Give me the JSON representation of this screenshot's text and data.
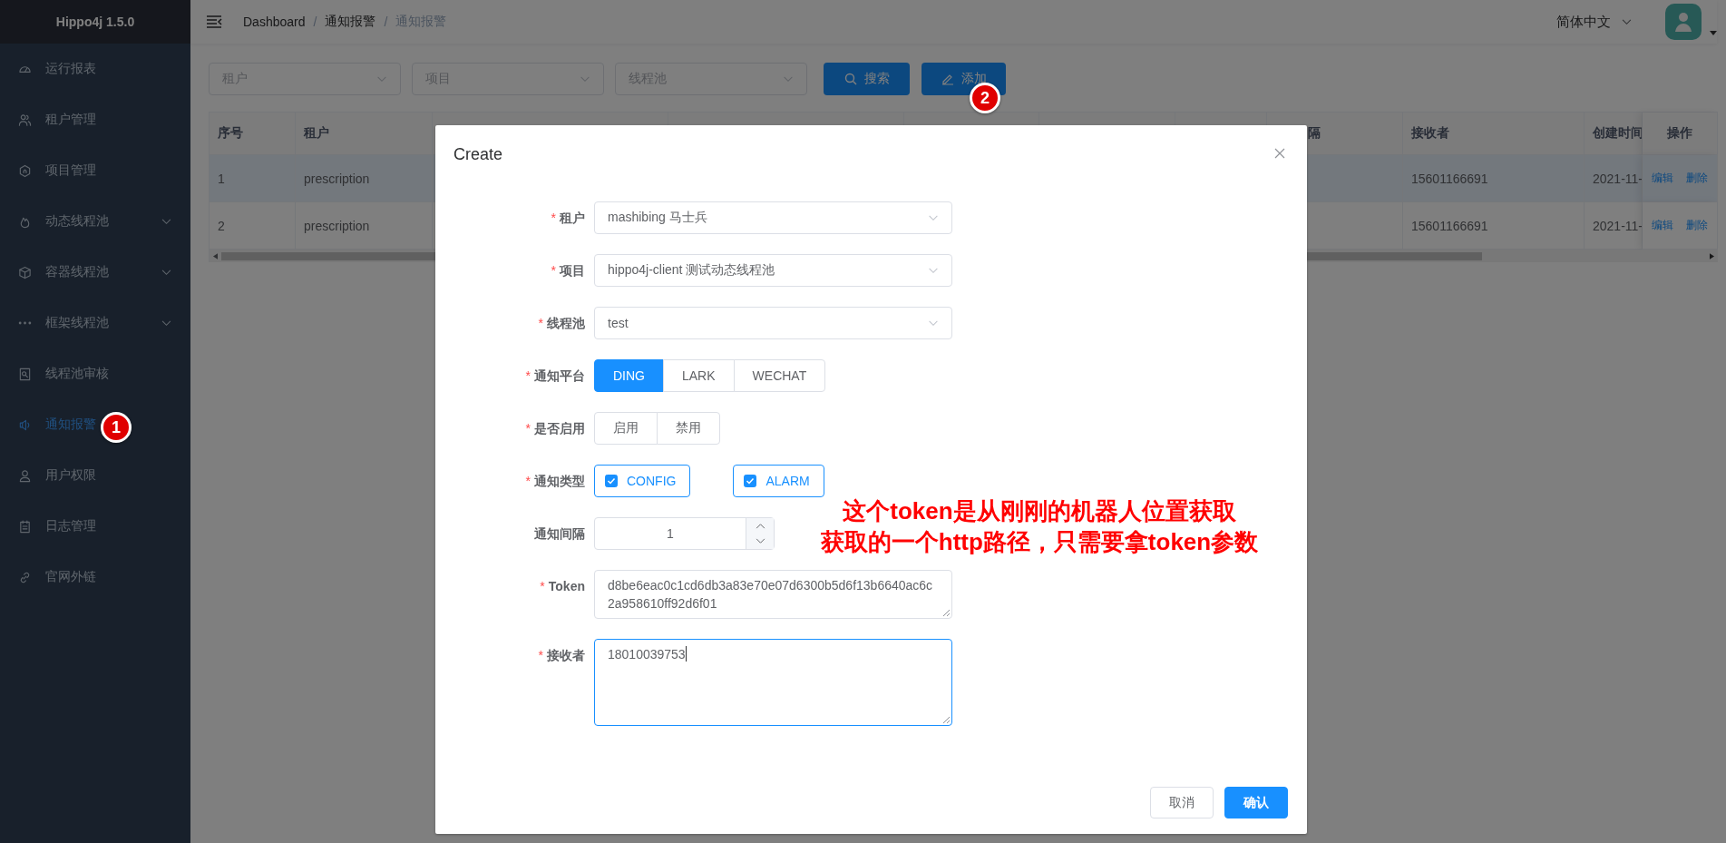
{
  "sidebar": {
    "title": "Hippo4j 1.5.0",
    "items": [
      {
        "label": "运行报表",
        "selected": false,
        "submenu": false
      },
      {
        "label": "租户管理",
        "selected": false,
        "submenu": false
      },
      {
        "label": "项目管理",
        "selected": false,
        "submenu": false
      },
      {
        "label": "动态线程池",
        "selected": false,
        "submenu": true
      },
      {
        "label": "容器线程池",
        "selected": false,
        "submenu": true
      },
      {
        "label": "框架线程池",
        "selected": false,
        "submenu": true
      },
      {
        "label": "线程池审核",
        "selected": false,
        "submenu": false
      },
      {
        "label": "通知报警",
        "selected": true,
        "submenu": false
      },
      {
        "label": "用户权限",
        "selected": false,
        "submenu": false
      },
      {
        "label": "日志管理",
        "selected": false,
        "submenu": false
      },
      {
        "label": "官网外链",
        "selected": false,
        "submenu": false
      }
    ]
  },
  "header": {
    "breadcrumb": [
      {
        "label": "Dashboard",
        "current": false
      },
      {
        "label": "通知报警",
        "current": false
      },
      {
        "label": "通知报警",
        "current": true
      }
    ],
    "separators": [
      "/",
      "/"
    ],
    "language": "简体中文"
  },
  "filters": {
    "selects": [
      {
        "placeholder": "租户"
      },
      {
        "placeholder": "项目"
      },
      {
        "placeholder": "线程池"
      }
    ],
    "buttons": [
      {
        "label": "搜索",
        "kind": "search"
      },
      {
        "label": "添加",
        "kind": "add"
      }
    ]
  },
  "table": {
    "columns": [
      {
        "label": "序号"
      },
      {
        "label": "租户"
      },
      {
        "label": "隔"
      },
      {
        "label": "接收者"
      },
      {
        "label": "创建时间"
      },
      {
        "label": "操作"
      }
    ],
    "rows": [
      {
        "selected": true,
        "cells": [
          "1",
          "prescription",
          "",
          "15601166691",
          "2021-11-"
        ],
        "actions": [
          "编辑",
          "删除"
        ]
      },
      {
        "selected": false,
        "cells": [
          "2",
          "prescription",
          "",
          "15601166691",
          "2021-11-"
        ],
        "actions": [
          "编辑",
          "删除"
        ]
      }
    ]
  },
  "dialog": {
    "title": "Create",
    "fields": [
      {
        "kind": "select",
        "label": "租户",
        "required_mark": "*",
        "value": "mashibing 马士兵"
      },
      {
        "kind": "select",
        "label": "项目",
        "required_mark": "*",
        "value": "hippo4j-client 测试动态线程池"
      },
      {
        "kind": "select",
        "label": "线程池",
        "required_mark": "*",
        "value": "test"
      },
      {
        "kind": "radio",
        "label": "通知平台",
        "required_mark": "*",
        "options": [
          {
            "label": "DING",
            "selected": true
          },
          {
            "label": "LARK",
            "selected": false
          },
          {
            "label": "WECHAT",
            "selected": false
          }
        ]
      },
      {
        "kind": "radio",
        "label": "是否启用",
        "required_mark": "*",
        "options": [
          {
            "label": "启用",
            "selected": false
          },
          {
            "label": "禁用",
            "selected": false
          }
        ]
      },
      {
        "kind": "checkbox",
        "label": "通知类型",
        "required_mark": "*",
        "options": [
          {
            "label": "CONFIG",
            "checked": true
          },
          {
            "label": "ALARM",
            "checked": true
          }
        ]
      },
      {
        "kind": "number",
        "label": "通知间隔",
        "value": "1"
      },
      {
        "kind": "textarea",
        "label": "Token",
        "required_mark": "*",
        "value": "d8be6eac0c1cd6db3a83e70e07d6300b5d6f13b6640ac6c2a958610ff92d6f01",
        "focused": false
      },
      {
        "kind": "textarea",
        "label": "接收者",
        "required_mark": "*",
        "value": "18010039753",
        "focused": true
      }
    ],
    "buttons": [
      {
        "label": "取消",
        "primary": false
      },
      {
        "label": "确认",
        "primary": true
      }
    ]
  },
  "annotations": {
    "badges": [
      {
        "number": "1"
      },
      {
        "number": "2"
      }
    ],
    "note": [
      "这个token是从刚刚的机器人位置获取",
      "获取的一个http路径，只需要拿token参数"
    ]
  }
}
